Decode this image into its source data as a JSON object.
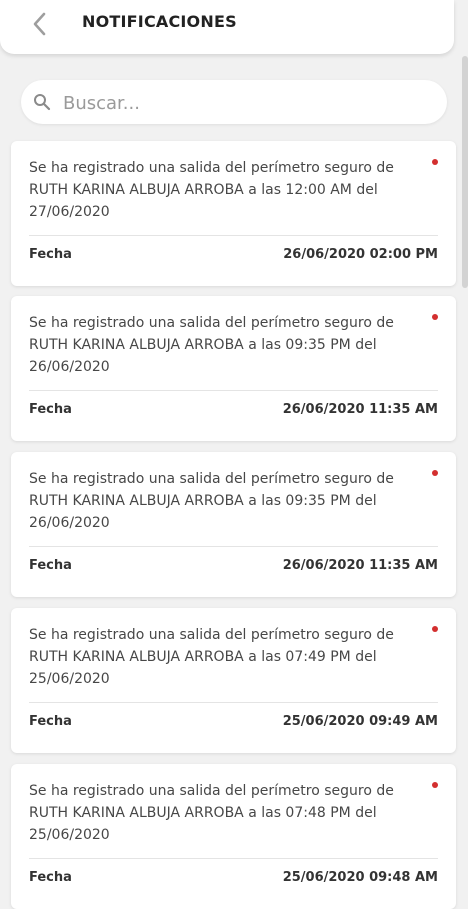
{
  "header": {
    "title": "NOTIFICACIONES",
    "back_icon": "chevron-left-icon"
  },
  "search": {
    "placeholder": "Buscar...",
    "value": "",
    "icon": "search-icon"
  },
  "notifications": [
    {
      "message": "Se ha registrado una salida del perímetro seguro de RUTH KARINA ALBUJA ARROBA a las 12:00 AM del 27/06/2020",
      "label": "Fecha",
      "date": "26/06/2020 02:00 PM",
      "unread": true
    },
    {
      "message": "Se ha registrado una salida del perímetro seguro de RUTH KARINA ALBUJA ARROBA a las 09:35 PM del 26/06/2020",
      "label": "Fecha",
      "date": "26/06/2020 11:35 AM",
      "unread": true
    },
    {
      "message": "Se ha registrado una salida del perímetro seguro de RUTH KARINA ALBUJA ARROBA a las 09:35 PM del 26/06/2020",
      "label": "Fecha",
      "date": "26/06/2020 11:35 AM",
      "unread": true
    },
    {
      "message": "Se ha registrado una salida del perímetro seguro de RUTH KARINA ALBUJA ARROBA a las 07:49 PM del 25/06/2020",
      "label": "Fecha",
      "date": "25/06/2020 09:49 AM",
      "unread": true
    },
    {
      "message": "Se ha registrado una salida del perímetro seguro de RUTH KARINA ALBUJA ARROBA a las 07:48 PM del 25/06/2020",
      "label": "Fecha",
      "date": "25/06/2020 09:48 AM",
      "unread": true
    }
  ],
  "colors": {
    "background": "#f1f1f1",
    "card": "#ffffff",
    "unread_dot": "#d32f2f",
    "text": "#333333"
  }
}
